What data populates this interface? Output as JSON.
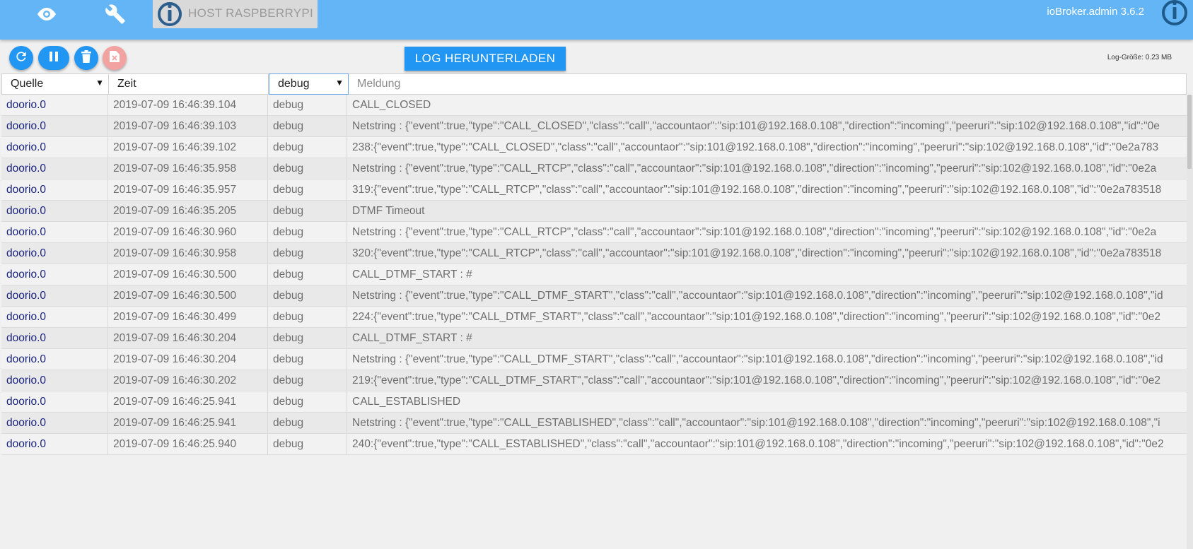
{
  "header": {
    "host_label": "HOST RASPBERRYPI",
    "version": "ioBroker.admin 3.6.2",
    "icons": [
      "eye-icon",
      "wrench-icon",
      "iobroker-logo-icon",
      "iobroker-logo-icon"
    ],
    "accent_color": "#64b5f6"
  },
  "toolbar": {
    "buttons": [
      "refresh-icon",
      "pause-icon",
      "trash-icon",
      "delete-file-icon"
    ],
    "download_label": "LOG HERUNTERLADEN",
    "log_size": "Log-Größe: 0.23 MB",
    "button_color": "#2196f3"
  },
  "filters": {
    "source": "Quelle",
    "time": "Zeit",
    "severity": "debug",
    "message_placeholder": "Meldung"
  },
  "log": [
    {
      "src": "doorio.0",
      "time": "2019-07-09 16:46:39.104",
      "sev": "debug",
      "msg": "CALL_CLOSED"
    },
    {
      "src": "doorio.0",
      "time": "2019-07-09 16:46:39.103",
      "sev": "debug",
      "msg": "Netstring : {\"event\":true,\"type\":\"CALL_CLOSED\",\"class\":\"call\",\"accountaor\":\"sip:101@192.168.0.108\",\"direction\":\"incoming\",\"peeruri\":\"sip:102@192.168.0.108\",\"id\":\"0e"
    },
    {
      "src": "doorio.0",
      "time": "2019-07-09 16:46:39.102",
      "sev": "debug",
      "msg": "238:{\"event\":true,\"type\":\"CALL_CLOSED\",\"class\":\"call\",\"accountaor\":\"sip:101@192.168.0.108\",\"direction\":\"incoming\",\"peeruri\":\"sip:102@192.168.0.108\",\"id\":\"0e2a783"
    },
    {
      "src": "doorio.0",
      "time": "2019-07-09 16:46:35.958",
      "sev": "debug",
      "msg": "Netstring : {\"event\":true,\"type\":\"CALL_RTCP\",\"class\":\"call\",\"accountaor\":\"sip:101@192.168.0.108\",\"direction\":\"incoming\",\"peeruri\":\"sip:102@192.168.0.108\",\"id\":\"0e2a"
    },
    {
      "src": "doorio.0",
      "time": "2019-07-09 16:46:35.957",
      "sev": "debug",
      "msg": "319:{\"event\":true,\"type\":\"CALL_RTCP\",\"class\":\"call\",\"accountaor\":\"sip:101@192.168.0.108\",\"direction\":\"incoming\",\"peeruri\":\"sip:102@192.168.0.108\",\"id\":\"0e2a783518"
    },
    {
      "src": "doorio.0",
      "time": "2019-07-09 16:46:35.205",
      "sev": "debug",
      "msg": "DTMF Timeout"
    },
    {
      "src": "doorio.0",
      "time": "2019-07-09 16:46:30.960",
      "sev": "debug",
      "msg": "Netstring : {\"event\":true,\"type\":\"CALL_RTCP\",\"class\":\"call\",\"accountaor\":\"sip:101@192.168.0.108\",\"direction\":\"incoming\",\"peeruri\":\"sip:102@192.168.0.108\",\"id\":\"0e2a"
    },
    {
      "src": "doorio.0",
      "time": "2019-07-09 16:46:30.958",
      "sev": "debug",
      "msg": "320:{\"event\":true,\"type\":\"CALL_RTCP\",\"class\":\"call\",\"accountaor\":\"sip:101@192.168.0.108\",\"direction\":\"incoming\",\"peeruri\":\"sip:102@192.168.0.108\",\"id\":\"0e2a783518"
    },
    {
      "src": "doorio.0",
      "time": "2019-07-09 16:46:30.500",
      "sev": "debug",
      "msg": "CALL_DTMF_START : #"
    },
    {
      "src": "doorio.0",
      "time": "2019-07-09 16:46:30.500",
      "sev": "debug",
      "msg": "Netstring : {\"event\":true,\"type\":\"CALL_DTMF_START\",\"class\":\"call\",\"accountaor\":\"sip:101@192.168.0.108\",\"direction\":\"incoming\",\"peeruri\":\"sip:102@192.168.0.108\",\"id"
    },
    {
      "src": "doorio.0",
      "time": "2019-07-09 16:46:30.499",
      "sev": "debug",
      "msg": "224:{\"event\":true,\"type\":\"CALL_DTMF_START\",\"class\":\"call\",\"accountaor\":\"sip:101@192.168.0.108\",\"direction\":\"incoming\",\"peeruri\":\"sip:102@192.168.0.108\",\"id\":\"0e2"
    },
    {
      "src": "doorio.0",
      "time": "2019-07-09 16:46:30.204",
      "sev": "debug",
      "msg": "CALL_DTMF_START : #"
    },
    {
      "src": "doorio.0",
      "time": "2019-07-09 16:46:30.204",
      "sev": "debug",
      "msg": "Netstring : {\"event\":true,\"type\":\"CALL_DTMF_START\",\"class\":\"call\",\"accountaor\":\"sip:101@192.168.0.108\",\"direction\":\"incoming\",\"peeruri\":\"sip:102@192.168.0.108\",\"id"
    },
    {
      "src": "doorio.0",
      "time": "2019-07-09 16:46:30.202",
      "sev": "debug",
      "msg": "219:{\"event\":true,\"type\":\"CALL_DTMF_START\",\"class\":\"call\",\"accountaor\":\"sip:101@192.168.0.108\",\"direction\":\"incoming\",\"peeruri\":\"sip:102@192.168.0.108\",\"id\":\"0e2"
    },
    {
      "src": "doorio.0",
      "time": "2019-07-09 16:46:25.941",
      "sev": "debug",
      "msg": "CALL_ESTABLISHED"
    },
    {
      "src": "doorio.0",
      "time": "2019-07-09 16:46:25.941",
      "sev": "debug",
      "msg": "Netstring : {\"event\":true,\"type\":\"CALL_ESTABLISHED\",\"class\":\"call\",\"accountaor\":\"sip:101@192.168.0.108\",\"direction\":\"incoming\",\"peeruri\":\"sip:102@192.168.0.108\",\"i"
    },
    {
      "src": "doorio.0",
      "time": "2019-07-09 16:46:25.940",
      "sev": "debug",
      "msg": "240:{\"event\":true,\"type\":\"CALL_ESTABLISHED\",\"class\":\"call\",\"accountaor\":\"sip:101@192.168.0.108\",\"direction\":\"incoming\",\"peeruri\":\"sip:102@192.168.0.108\",\"id\":\"0e2"
    }
  ]
}
